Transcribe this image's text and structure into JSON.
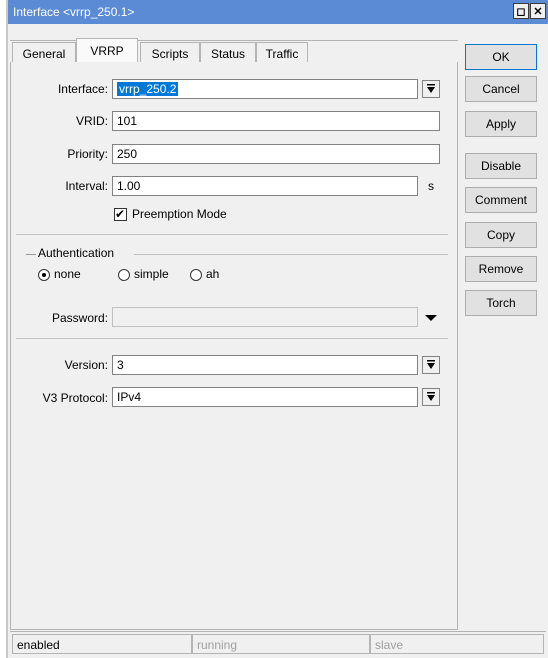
{
  "window": {
    "title": "Interface <vrrp_250.1>",
    "restore_glyph": "◻",
    "close_glyph": "✕"
  },
  "tabs": [
    {
      "label": "General"
    },
    {
      "label": "VRRP"
    },
    {
      "label": "Scripts"
    },
    {
      "label": "Status"
    },
    {
      "label": "Traffic"
    }
  ],
  "form": {
    "interface": {
      "label": "Interface:",
      "value": "vrrp_250.2"
    },
    "vrid": {
      "label": "VRID:",
      "value": "101"
    },
    "priority": {
      "label": "Priority:",
      "value": "250"
    },
    "interval": {
      "label": "Interval:",
      "value": "1.00",
      "unit": "s"
    },
    "preemption": {
      "label": "Preemption Mode",
      "checked": true,
      "check_glyph": "✔"
    },
    "authentication": {
      "group_label": "Authentication",
      "options": [
        {
          "label": "none",
          "selected": true
        },
        {
          "label": "simple",
          "selected": false
        },
        {
          "label": "ah",
          "selected": false
        }
      ]
    },
    "password": {
      "label": "Password:",
      "value": ""
    },
    "version": {
      "label": "Version:",
      "value": "3"
    },
    "v3_protocol": {
      "label": "V3 Protocol:",
      "value": "IPv4"
    }
  },
  "buttons": {
    "ok": "OK",
    "cancel": "Cancel",
    "apply": "Apply",
    "disable": "Disable",
    "comment": "Comment",
    "copy": "Copy",
    "remove": "Remove",
    "torch": "Torch"
  },
  "status": {
    "enabled": "enabled",
    "running": "running",
    "slave": "slave"
  },
  "icons": {
    "dropdown": "chevron-down-icon",
    "arrow": "arrow-down-icon"
  },
  "colors": {
    "titlebar": "#5c8bd6",
    "selection": "#0078d7"
  }
}
